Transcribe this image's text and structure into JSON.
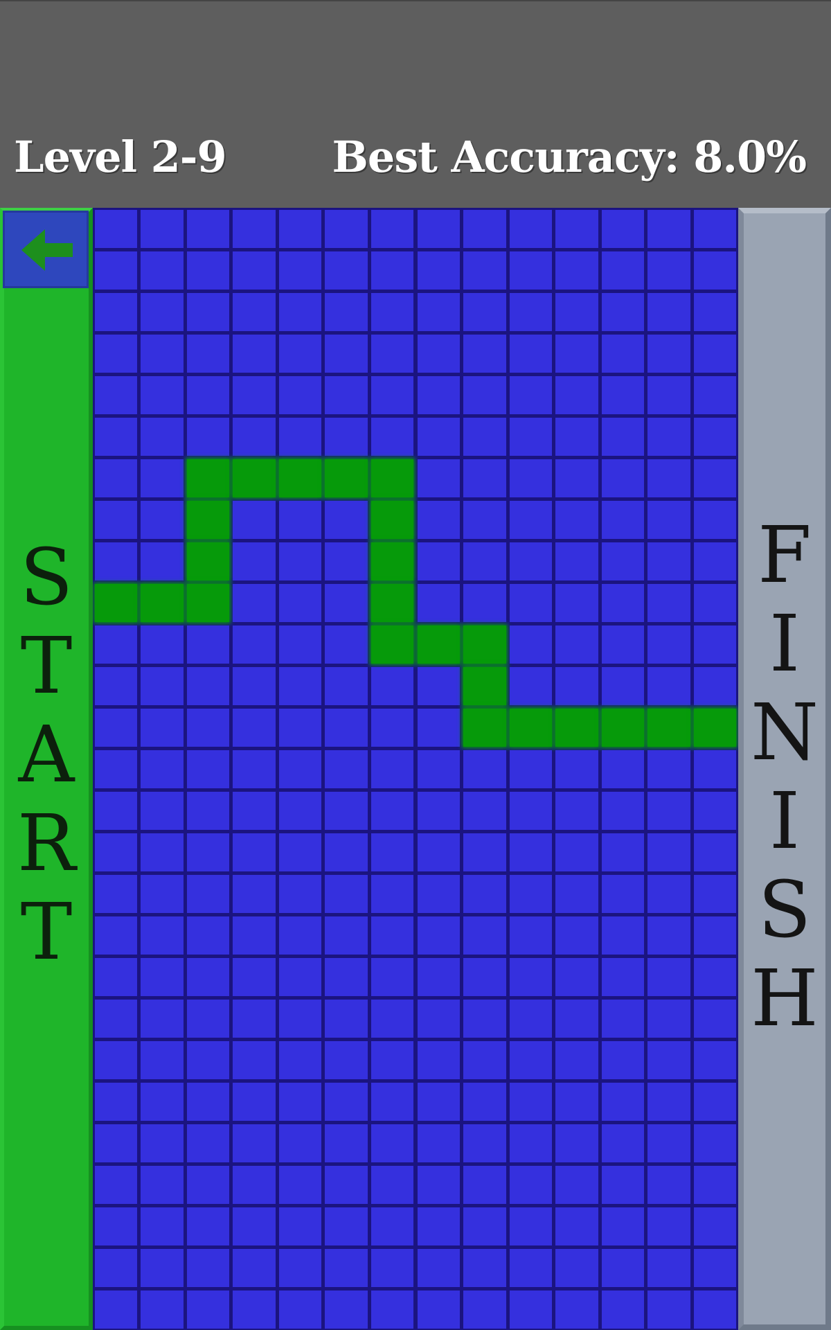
{
  "header": {
    "level": "Level 2-9",
    "best_accuracy": "Best Accuracy: 8.0%"
  },
  "start_label": [
    "S",
    "T",
    "A",
    "R",
    "T"
  ],
  "finish_label": [
    "F",
    "I",
    "N",
    "I",
    "S",
    "H"
  ],
  "back_button": {
    "icon": "arrow-left-icon"
  },
  "grid": {
    "columns": 14,
    "rows": 27,
    "cell_color": "#3530de",
    "line_color": "#1b1480",
    "path_color": "#069a0a",
    "path_cells": [
      [
        9,
        0
      ],
      [
        9,
        1
      ],
      [
        9,
        2
      ],
      [
        8,
        2
      ],
      [
        7,
        2
      ],
      [
        6,
        2
      ],
      [
        6,
        3
      ],
      [
        6,
        4
      ],
      [
        6,
        5
      ],
      [
        6,
        6
      ],
      [
        7,
        6
      ],
      [
        8,
        6
      ],
      [
        9,
        6
      ],
      [
        10,
        6
      ],
      [
        10,
        7
      ],
      [
        10,
        8
      ],
      [
        11,
        8
      ],
      [
        12,
        8
      ],
      [
        12,
        9
      ],
      [
        12,
        10
      ],
      [
        12,
        11
      ],
      [
        12,
        12
      ],
      [
        12,
        13
      ]
    ]
  },
  "colors": {
    "start_panel": "#1fb52a",
    "finish_panel": "#9aa4b3",
    "header_bg": "#5e5e5e"
  }
}
